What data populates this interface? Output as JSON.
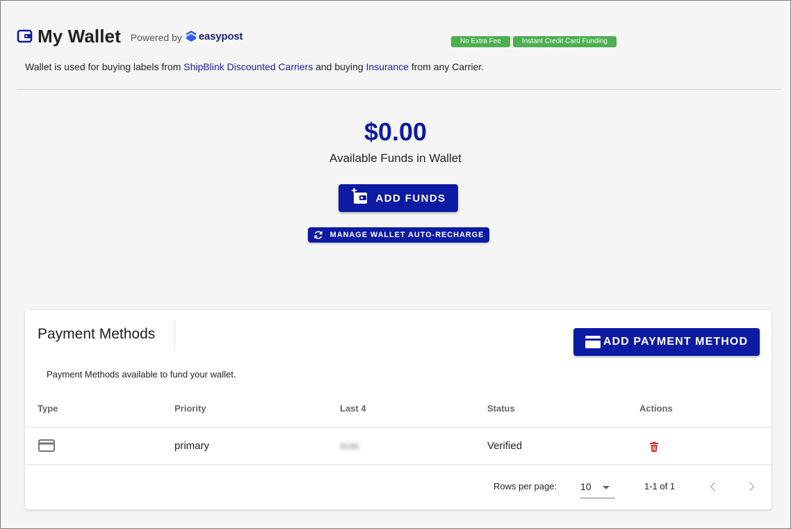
{
  "header": {
    "title": "My Wallet",
    "powered_by": "Powered by",
    "brand": "easypost",
    "badges": [
      "No Extra Fee",
      "Instant Credit Card Funding"
    ],
    "description_pre": "Wallet is used for buying labels from ",
    "description_link1": "ShipBlink Discounted Carriers",
    "description_mid": " and buying ",
    "description_link2": "Insurance",
    "description_post": " from any Carrier."
  },
  "funds": {
    "amount": "$0.00",
    "label": "Available Funds in Wallet",
    "add_funds_label": "ADD FUNDS",
    "auto_recharge_label": "MANAGE WALLET AUTO-RECHARGE"
  },
  "payment_methods": {
    "title": "Payment Methods",
    "add_label": "ADD PAYMENT METHOD",
    "subtitle": "Payment Methods available to fund your wallet.",
    "columns": [
      "Type",
      "Priority",
      "Last 4",
      "Status",
      "Actions"
    ],
    "rows": [
      {
        "type_icon": "credit-card-icon",
        "priority": "primary",
        "last4": "4144",
        "status": "Verified",
        "action_icon": "trash-icon"
      }
    ],
    "pagination": {
      "rows_per_page_label": "Rows per page:",
      "rows_per_page": "10",
      "range": "1-1 of 1"
    }
  },
  "colors": {
    "primary": "#0d1aa3",
    "badge": "#4caf50",
    "link": "#1a1aa8",
    "delete": "#d32f2f"
  }
}
